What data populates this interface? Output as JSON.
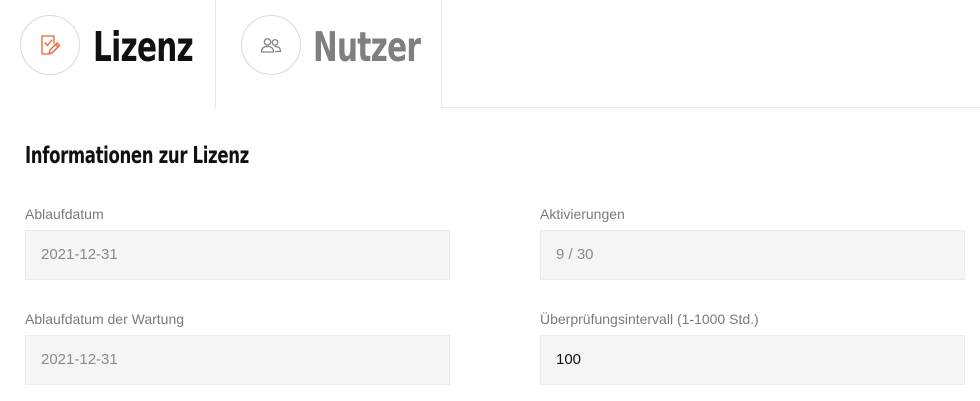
{
  "tabs": [
    {
      "label": "Lizenz",
      "icon": "license-document-icon",
      "active": true
    },
    {
      "label": "Nutzer",
      "icon": "users-icon",
      "active": false
    }
  ],
  "section": {
    "title": "Informationen zur Lizenz"
  },
  "fields": {
    "expiry": {
      "label": "Ablaufdatum",
      "value": "2021-12-31"
    },
    "activations": {
      "label": "Aktivierungen",
      "value": "9 / 30"
    },
    "maintenance_expiry": {
      "label": "Ablaufdatum der Wartung",
      "value": "2021-12-31"
    },
    "check_interval": {
      "label": "Überprüfungsintervall (1-1000 Std.)",
      "value": "100"
    }
  },
  "colors": {
    "accent": "#e8642c",
    "active_tab_text": "#111111",
    "inactive_tab_text": "#7f7f7f",
    "field_background": "#f5f5f5"
  }
}
